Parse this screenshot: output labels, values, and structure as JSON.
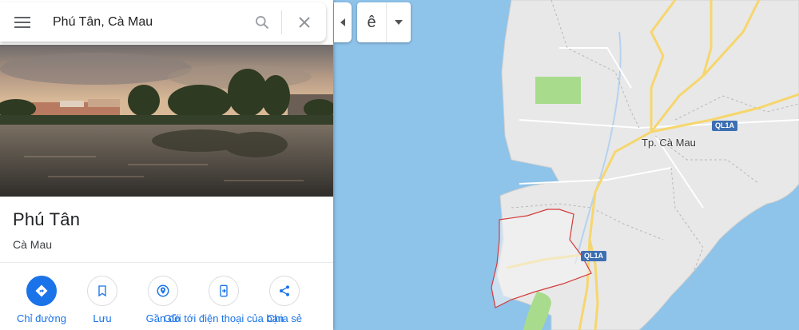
{
  "search": {
    "query": "Phú Tân, Cà Mau",
    "menu_icon": "hamburger-menu-icon",
    "search_icon": "search-icon",
    "clear_icon": "close-icon"
  },
  "place": {
    "name": "Phú Tân",
    "subtitle": "Cà Mau"
  },
  "actions": [
    {
      "label": "Chỉ đường",
      "icon": "directions-icon"
    },
    {
      "label": "Lưu",
      "icon": "bookmark-icon"
    },
    {
      "label": "Gần đó",
      "icon": "nearby-icon"
    },
    {
      "label": "Gửi tới điện thoại của bạn",
      "icon": "send-to-phone-icon"
    },
    {
      "label": "Chia sẻ",
      "icon": "share-icon"
    }
  ],
  "map": {
    "city_label": "Tp. Cà Mau",
    "road_shields": [
      "QL1A",
      "QL1A"
    ],
    "layer_toggle": "ê"
  },
  "colors": {
    "accent": "#1a73e8",
    "water": "#8ec3ea",
    "land": "#e8e8e8",
    "park": "#a8dc8c",
    "road": "#f6d66d",
    "boundary": "#d33b3b",
    "shield": "#3d6fb2"
  }
}
